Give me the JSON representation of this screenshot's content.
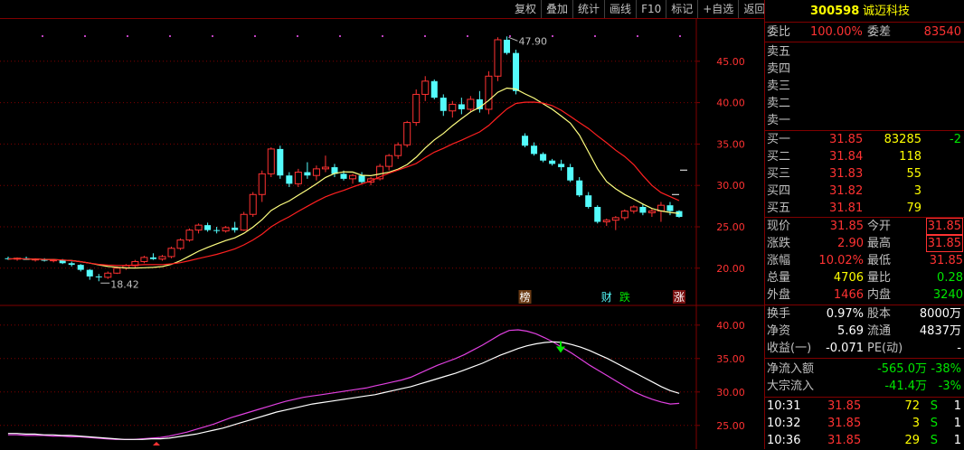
{
  "toolbar": {
    "buttons": [
      "复权",
      "叠加",
      "统计",
      "画线",
      "F10",
      "标记",
      "+自选",
      "返回"
    ]
  },
  "chart_data": [
    {
      "type": "candlestick",
      "y_ticks": [
        "45.00",
        "40.00",
        "35.00",
        "30.00",
        "25.00",
        "20.00"
      ],
      "ylim": [
        15.5,
        50
      ],
      "candles": [
        [
          21.2,
          21.4,
          21.0,
          21.1
        ],
        [
          21.1,
          21.3,
          20.9,
          21.2
        ],
        [
          21.2,
          21.4,
          21.0,
          21.0
        ],
        [
          21.0,
          21.2,
          20.8,
          21.1
        ],
        [
          21.1,
          21.2,
          20.8,
          20.9
        ],
        [
          20.9,
          21.1,
          20.7,
          21.0
        ],
        [
          21.0,
          21.1,
          20.5,
          20.6
        ],
        [
          20.6,
          20.8,
          20.2,
          20.4
        ],
        [
          20.4,
          20.5,
          19.6,
          19.8
        ],
        [
          19.8,
          19.9,
          18.6,
          19.0
        ],
        [
          19.0,
          19.3,
          18.42,
          18.9
        ],
        [
          18.9,
          19.6,
          18.7,
          19.4
        ],
        [
          19.4,
          20.2,
          19.3,
          20.0
        ],
        [
          20.0,
          20.5,
          19.8,
          20.3
        ],
        [
          20.3,
          21.0,
          20.1,
          20.8
        ],
        [
          20.8,
          21.5,
          20.6,
          21.3
        ],
        [
          21.3,
          21.8,
          21.0,
          21.1
        ],
        [
          21.1,
          21.6,
          20.9,
          21.4
        ],
        [
          21.4,
          22.6,
          21.2,
          22.4
        ],
        [
          22.4,
          23.6,
          22.2,
          23.4
        ],
        [
          23.4,
          24.8,
          23.2,
          24.6
        ],
        [
          24.6,
          25.4,
          24.2,
          25.2
        ],
        [
          25.2,
          25.5,
          24.4,
          24.6
        ],
        [
          24.6,
          25.0,
          24.2,
          24.5
        ],
        [
          24.5,
          25.1,
          24.3,
          24.9
        ],
        [
          24.9,
          25.6,
          24.3,
          24.6
        ],
        [
          24.6,
          26.8,
          24.5,
          26.5
        ],
        [
          26.5,
          29.2,
          26.2,
          28.9
        ],
        [
          28.9,
          31.8,
          28.0,
          31.4
        ],
        [
          31.4,
          34.6,
          31.0,
          34.4
        ],
        [
          34.4,
          34.8,
          30.8,
          31.2
        ],
        [
          31.2,
          31.6,
          29.8,
          30.2
        ],
        [
          30.2,
          32.0,
          29.8,
          31.6
        ],
        [
          31.6,
          32.8,
          30.8,
          31.2
        ],
        [
          31.2,
          32.4,
          30.6,
          32.0
        ],
        [
          32.0,
          33.6,
          31.6,
          32.2
        ],
        [
          32.2,
          32.6,
          31.0,
          31.4
        ],
        [
          31.4,
          31.8,
          30.6,
          30.8
        ],
        [
          30.8,
          31.4,
          30.2,
          31.2
        ],
        [
          31.2,
          31.6,
          30.2,
          30.4
        ],
        [
          30.4,
          31.0,
          30.0,
          30.8
        ],
        [
          30.8,
          32.6,
          30.6,
          32.3
        ],
        [
          32.3,
          33.8,
          31.8,
          33.6
        ],
        [
          33.6,
          35.2,
          33.2,
          34.9
        ],
        [
          34.9,
          37.8,
          34.6,
          37.6
        ],
        [
          37.6,
          41.6,
          37.2,
          41.0
        ],
        [
          41.0,
          43.2,
          40.2,
          42.6
        ],
        [
          42.6,
          42.8,
          40.4,
          40.6
        ],
        [
          40.6,
          41.0,
          38.4,
          39.0
        ],
        [
          39.0,
          40.2,
          38.2,
          39.8
        ],
        [
          39.8,
          40.6,
          38.6,
          39.2
        ],
        [
          39.2,
          40.8,
          38.8,
          40.4
        ],
        [
          40.4,
          41.4,
          38.8,
          39.2
        ],
        [
          39.2,
          43.8,
          38.6,
          43.2
        ],
        [
          43.2,
          47.9,
          42.6,
          47.6
        ],
        [
          47.6,
          48.0,
          45.8,
          46.0
        ],
        [
          46.0,
          46.4,
          41.0,
          41.4
        ],
        [
          36.0,
          36.3,
          34.6,
          34.8
        ],
        [
          34.8,
          35.2,
          33.6,
          33.8
        ],
        [
          33.8,
          34.0,
          32.8,
          33.0
        ],
        [
          33.0,
          33.2,
          32.4,
          32.6
        ],
        [
          32.6,
          33.1,
          31.8,
          32.2
        ],
        [
          32.2,
          32.6,
          30.4,
          30.6
        ],
        [
          30.6,
          31.0,
          28.6,
          28.8
        ],
        [
          28.8,
          29.2,
          27.2,
          27.4
        ],
        [
          27.4,
          27.6,
          25.4,
          25.6
        ],
        [
          25.6,
          26.0,
          25.1,
          25.8
        ],
        [
          25.8,
          26.3,
          24.6,
          26.1
        ],
        [
          26.1,
          27.1,
          25.8,
          26.9
        ],
        [
          26.9,
          27.6,
          26.6,
          27.4
        ],
        [
          27.4,
          27.8,
          26.4,
          26.7
        ],
        [
          26.7,
          27.2,
          26.2,
          26.9
        ],
        [
          26.9,
          28.0,
          25.6,
          27.6
        ],
        [
          27.6,
          28.0,
          26.4,
          26.9
        ],
        [
          26.9,
          27.0,
          26.1,
          26.2
        ]
      ],
      "low_label": "18.42",
      "high_label": "47.90",
      "event_markers": [
        {
          "text": "榜",
          "color": "#ffffff",
          "bg": "#6a3a14",
          "index": 57
        },
        {
          "text": "财",
          "color": "#54fcfc",
          "bg": "none",
          "index": 66
        },
        {
          "text": "跌",
          "color": "#00e600",
          "bg": "none",
          "index": 68
        },
        {
          "text": "涨",
          "color": "#ffffff",
          "bg": "#7a1010",
          "index": 74
        }
      ]
    },
    {
      "type": "line",
      "y_ticks": [
        "40.00",
        "35.00",
        "30.00",
        "25.00"
      ],
      "ylim": [
        22,
        42
      ],
      "series": [
        {
          "color": "#e040e0",
          "values": [
            23.6,
            23.6,
            23.5,
            23.5,
            23.5,
            23.4,
            23.4,
            23.3,
            23.3,
            23.2,
            23.1,
            23.0,
            22.9,
            22.9,
            22.9,
            23.0,
            23.1,
            23.2,
            23.4,
            23.7,
            24.0,
            24.4,
            24.8,
            25.2,
            25.7,
            26.2,
            26.6,
            27.0,
            27.4,
            27.8,
            28.2,
            28.6,
            28.9,
            29.2,
            29.4,
            29.6,
            29.8,
            30.0,
            30.2,
            30.4,
            30.6,
            30.9,
            31.2,
            31.5,
            31.8,
            32.2,
            32.8,
            33.4,
            34.0,
            34.5,
            35.0,
            35.6,
            36.3,
            37.0,
            37.8,
            38.6,
            39.2,
            39.3,
            39.1,
            38.7,
            38.1,
            37.4,
            36.6,
            35.8,
            34.9,
            34.0,
            33.2,
            32.4,
            31.6,
            30.8,
            30.0,
            29.4,
            28.9,
            28.5,
            28.2,
            28.3
          ]
        },
        {
          "color": "#ffffff",
          "values": [
            23.8,
            23.8,
            23.7,
            23.7,
            23.6,
            23.6,
            23.5,
            23.5,
            23.4,
            23.3,
            23.2,
            23.1,
            23.0,
            22.9,
            22.9,
            22.9,
            23.0,
            23.0,
            23.1,
            23.3,
            23.5,
            23.7,
            24.0,
            24.3,
            24.6,
            25.0,
            25.4,
            25.8,
            26.2,
            26.6,
            27.0,
            27.3,
            27.6,
            27.9,
            28.2,
            28.4,
            28.6,
            28.8,
            29.0,
            29.2,
            29.4,
            29.6,
            29.9,
            30.2,
            30.5,
            30.8,
            31.2,
            31.6,
            32.0,
            32.4,
            32.8,
            33.3,
            33.8,
            34.3,
            34.9,
            35.5,
            36.0,
            36.5,
            36.9,
            37.2,
            37.4,
            37.5,
            37.4,
            37.1,
            36.7,
            36.2,
            35.6,
            35.0,
            34.3,
            33.6,
            32.9,
            32.2,
            31.5,
            30.8,
            30.2,
            29.8
          ]
        }
      ]
    }
  ],
  "right_panel": {
    "stock_code": "300598",
    "stock_name": "诚迈科技",
    "weibi_label": "委比",
    "weibi_value": "100.00%",
    "weicha_label": "委差",
    "weicha_value": "83540",
    "sells": [
      {
        "label": "卖五"
      },
      {
        "label": "卖四"
      },
      {
        "label": "卖三"
      },
      {
        "label": "卖二"
      },
      {
        "label": "卖一"
      }
    ],
    "buys": [
      {
        "label": "买一",
        "price": "31.85",
        "volume": "83285",
        "change": "-2"
      },
      {
        "label": "买二",
        "price": "31.84",
        "volume": "118",
        "change": ""
      },
      {
        "label": "买三",
        "price": "31.83",
        "volume": "55",
        "change": ""
      },
      {
        "label": "买四",
        "price": "31.82",
        "volume": "3",
        "change": ""
      },
      {
        "label": "买五",
        "price": "31.81",
        "volume": "79",
        "change": ""
      }
    ],
    "quote": [
      {
        "l1": "现价",
        "v1": "31.85",
        "l2": "今开",
        "v2": "31.85",
        "c1": "red",
        "c2": "red",
        "box2": true
      },
      {
        "l1": "涨跌",
        "v1": "2.90",
        "l2": "最高",
        "v2": "31.85",
        "c1": "red",
        "c2": "red",
        "box2": true
      },
      {
        "l1": "涨幅",
        "v1": "10.02%",
        "l2": "最低",
        "v2": "31.85",
        "c1": "red",
        "c2": "red",
        "box2": false
      },
      {
        "l1": "总量",
        "v1": "4706",
        "l2": "量比",
        "v2": "0.28",
        "c1": "yellow",
        "c2": "green",
        "box2": false
      },
      {
        "l1": "外盘",
        "v1": "1466",
        "l2": "内盘",
        "v2": "3240",
        "c1": "red",
        "c2": "green",
        "box2": false
      }
    ],
    "info": [
      {
        "l1": "换手",
        "v1": "0.97%",
        "l2": "股本",
        "v2": "8000万"
      },
      {
        "l1": "净资",
        "v1": "5.69",
        "l2": "流通",
        "v2": "4837万"
      },
      {
        "l1": "收益(一)",
        "v1": "-0.071",
        "l2": "PE(动)",
        "v2": "-"
      }
    ],
    "flows": [
      {
        "label": "净流入额",
        "value": "-565.0万",
        "pct": "-38%"
      },
      {
        "label": "大宗流入",
        "value": "-41.4万",
        "pct": "-3%"
      }
    ],
    "ticks": [
      {
        "time": "10:31",
        "price": "31.85",
        "vol": "72",
        "side": "S",
        "count": "1"
      },
      {
        "time": "10:32",
        "price": "31.85",
        "vol": "3",
        "side": "S",
        "count": "1"
      },
      {
        "time": "10:36",
        "price": "31.85",
        "vol": "29",
        "side": "S",
        "count": "1"
      }
    ]
  }
}
